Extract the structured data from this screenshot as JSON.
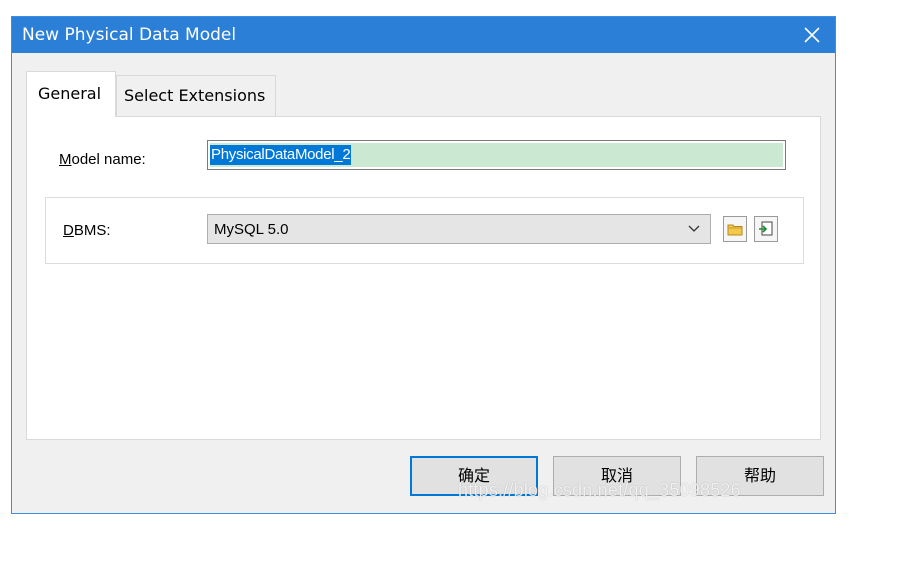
{
  "window": {
    "title": "New Physical Data Model",
    "close_icon": "close-icon"
  },
  "tabs": [
    {
      "label": "General",
      "selected": true
    },
    {
      "label": "Select Extensions",
      "selected": false
    }
  ],
  "form": {
    "model_name_label": "Model name:",
    "model_name_value": "PhysicalDataModel_2",
    "dbms_label": "DBMS:",
    "dbms_value": "MySQL 5.0",
    "folder_icon": "folder-icon",
    "import_icon": "import-icon"
  },
  "buttons": {
    "ok": "确定",
    "cancel": "取消",
    "help": "帮助"
  },
  "watermark": "https://blog.csdn.net/qq_35098526",
  "colors": {
    "titlebar": "#2b7fd6",
    "selection": "#0078d7",
    "input_fill": "#cbe8d2"
  }
}
